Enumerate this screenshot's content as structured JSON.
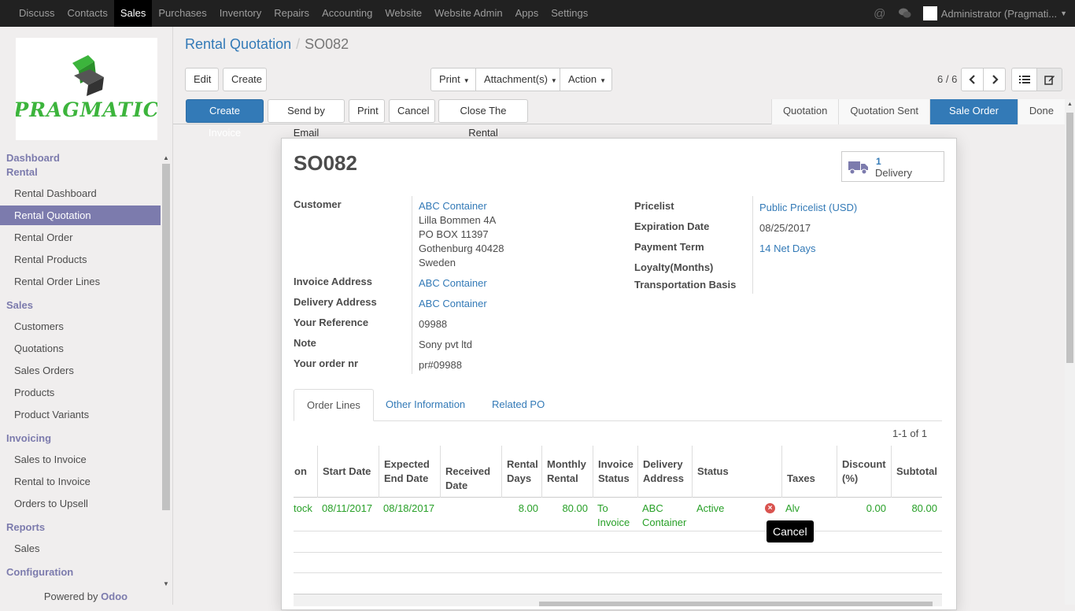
{
  "topbar": {
    "menu": [
      "Discuss",
      "Contacts",
      "Sales",
      "Purchases",
      "Inventory",
      "Repairs",
      "Accounting",
      "Website",
      "Website Admin",
      "Apps",
      "Settings"
    ],
    "active": "Sales",
    "user": "Administrator (Pragmati..."
  },
  "sidebar": {
    "logo_text": "PRAGMATIC",
    "sections": [
      {
        "title": "Dashboard",
        "items": []
      },
      {
        "title": "Rental",
        "items": [
          "Rental Dashboard",
          "Rental Quotation",
          "Rental Order",
          "Rental Products",
          "Rental Order Lines"
        ]
      },
      {
        "title": "Sales",
        "items": [
          "Customers",
          "Quotations",
          "Sales Orders",
          "Products",
          "Product Variants"
        ]
      },
      {
        "title": "Invoicing",
        "items": [
          "Sales to Invoice",
          "Rental to Invoice",
          "Orders to Upsell"
        ]
      },
      {
        "title": "Reports",
        "items": [
          "Sales"
        ]
      },
      {
        "title": "Configuration",
        "items": []
      }
    ],
    "active_item": "Rental Quotation",
    "powered_prefix": "Powered by",
    "powered_brand": "Odoo"
  },
  "breadcrumb": {
    "parent": "Rental Quotation",
    "current": "SO082"
  },
  "toolbar": {
    "edit": "Edit",
    "create": "Create",
    "print": "Print",
    "attachments": "Attachment(s)",
    "action": "Action",
    "pager": "6 / 6"
  },
  "header_buttons": {
    "create_invoice": "Create Invoice",
    "send_email": "Send by Email",
    "print": "Print",
    "cancel": "Cancel",
    "close_rental": "Close The Rental"
  },
  "stages": [
    "Quotation",
    "Quotation Sent",
    "Sale Order",
    "Done"
  ],
  "current_stage": "Sale Order",
  "form": {
    "name": "SO082",
    "delivery_count": "1",
    "delivery_label": "Delivery",
    "left": {
      "customer_label": "Customer",
      "customer_name": "ABC Container",
      "address_1": "Lilla Bommen 4A",
      "address_2": "PO BOX 11397",
      "address_3": "Gothenburg 40428",
      "address_4": "Sweden",
      "invoice_address_label": "Invoice Address",
      "invoice_address": "ABC Container",
      "delivery_address_label": "Delivery Address",
      "delivery_address": "ABC Container",
      "reference_label": "Your Reference",
      "reference": "09988",
      "note_label": "Note",
      "note": "Sony pvt ltd",
      "order_nr_label": "Your order nr",
      "order_nr": "pr#09988"
    },
    "right": {
      "pricelist_label": "Pricelist",
      "pricelist": "Public Pricelist (USD)",
      "expiration_label": "Expiration Date",
      "expiration": "08/25/2017",
      "payment_term_label": "Payment Term",
      "payment_term": "14 Net Days",
      "loyalty_label": "Loyalty(Months)",
      "transport_label": "Transportation Basis"
    }
  },
  "tabs": [
    "Order Lines",
    "Other Information",
    "Related PO"
  ],
  "active_tab": "Order Lines",
  "table": {
    "count": "1-1 of 1",
    "headers": {
      "h0": "on",
      "h1": "Start Date",
      "h2a": "Expected",
      "h2b": "End Date",
      "h3a": "Received",
      "h3b": "Date",
      "h4a": "Rental",
      "h4b": "Days",
      "h5a": "Monthly",
      "h5b": "Rental",
      "h6a": "Invoice",
      "h6b": "Status",
      "h7a": "Delivery",
      "h7b": "Address",
      "h8": "Status",
      "h9": "Taxes",
      "h10a": "Discount",
      "h10b": "(%)",
      "h11": "Subtotal"
    },
    "row": {
      "c0": "tock",
      "start_date": "08/11/2017",
      "end_date": "08/18/2017",
      "received_date": "",
      "rental_days": "8.00",
      "monthly_rental": "80.00",
      "invoice_status_a": "To",
      "invoice_status_b": "Invoice",
      "delivery_address_a": "ABC",
      "delivery_address_b": "Container",
      "status": "Active",
      "taxes": "Alv",
      "discount": "0.00",
      "subtotal": "80.00"
    }
  },
  "tooltip": "Cancel",
  "colors": {
    "accent": "#7c7bad",
    "primary": "#337ab7",
    "row_text": "#28a028",
    "danger": "#d9534f"
  }
}
